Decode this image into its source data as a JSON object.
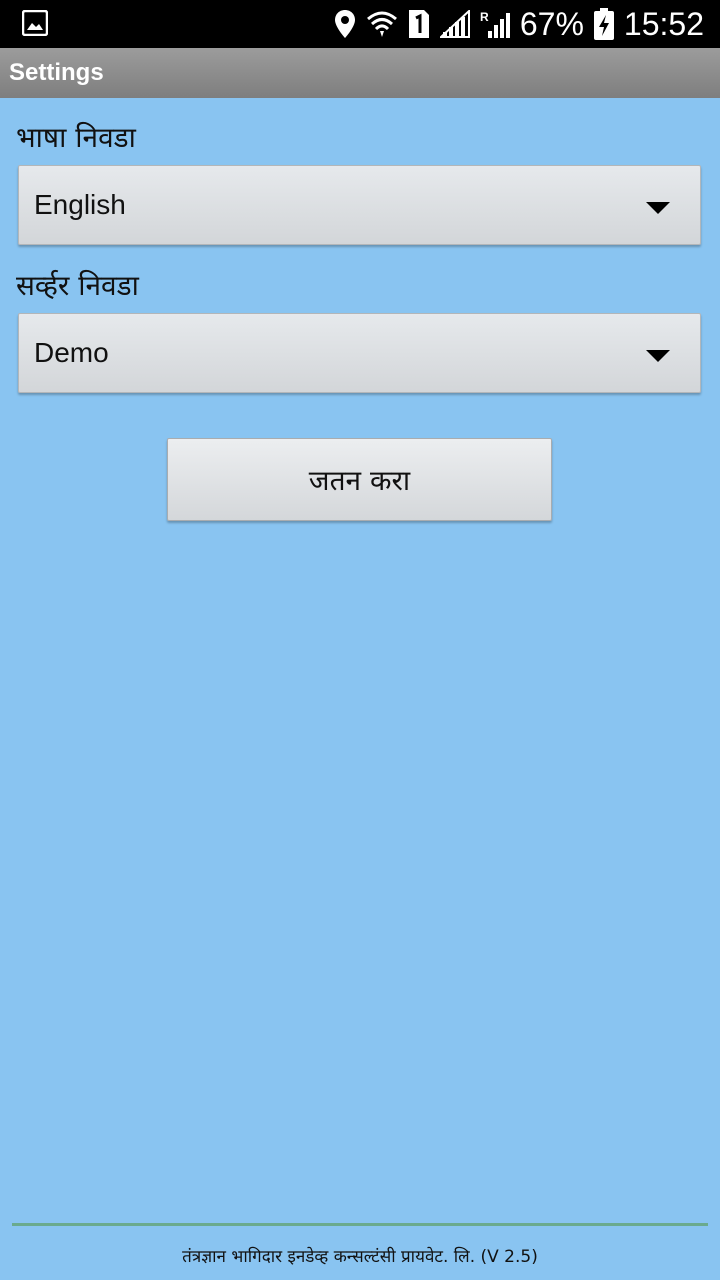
{
  "status_bar": {
    "battery": "67%",
    "time": "15:52",
    "icons": [
      "gallery-icon",
      "location-icon",
      "wifi-icon",
      "sim1-icon",
      "signal-icon",
      "roaming-signal-icon",
      "battery-charging-icon"
    ]
  },
  "title_bar": {
    "title": "Settings"
  },
  "language": {
    "label": "भाषा निवडा",
    "selected": "English"
  },
  "server": {
    "label": "सर्व्हर निवडा",
    "selected": "Demo"
  },
  "save_button": {
    "label": "जतन करा"
  },
  "footer": {
    "text": "तंत्रज्ञान भागिदार इनडेव्ह कन्सल्टंसी प्रायवेट. लि. (V 2.5)"
  },
  "colors": {
    "background": "#89c4f1",
    "title_bar": "#8d8d8d",
    "footer_line": "#6aaa8e"
  }
}
